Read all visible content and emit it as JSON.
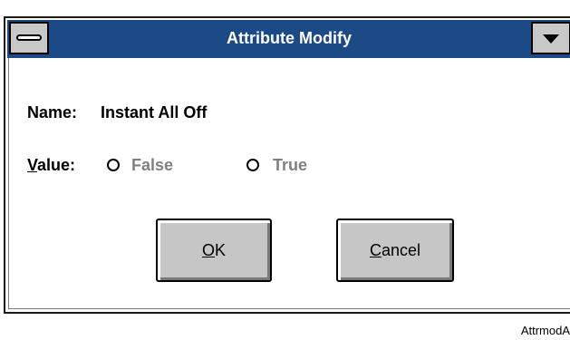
{
  "window": {
    "title": "Attribute Modify"
  },
  "fields": {
    "name_label_mn": "N",
    "name_label_rest": "ame:",
    "name_value": "Instant All Off",
    "value_label_mn": "V",
    "value_label_rest": "alue:"
  },
  "options": [
    {
      "label": "False",
      "selected": false,
      "enabled": false
    },
    {
      "label": "True",
      "selected": false,
      "enabled": false
    }
  ],
  "buttons": {
    "ok_mn": "O",
    "ok_rest": "K",
    "cancel_mn": "C",
    "cancel_rest": "ancel"
  },
  "caption": "AttrmodA",
  "colors": {
    "titlebar": "#1b4a86",
    "disabled_text": "#808080",
    "button_face": "#c6c6c6"
  },
  "icons": {
    "system_menu": "minus-bar-icon",
    "dropdown": "triangle-down-icon"
  }
}
